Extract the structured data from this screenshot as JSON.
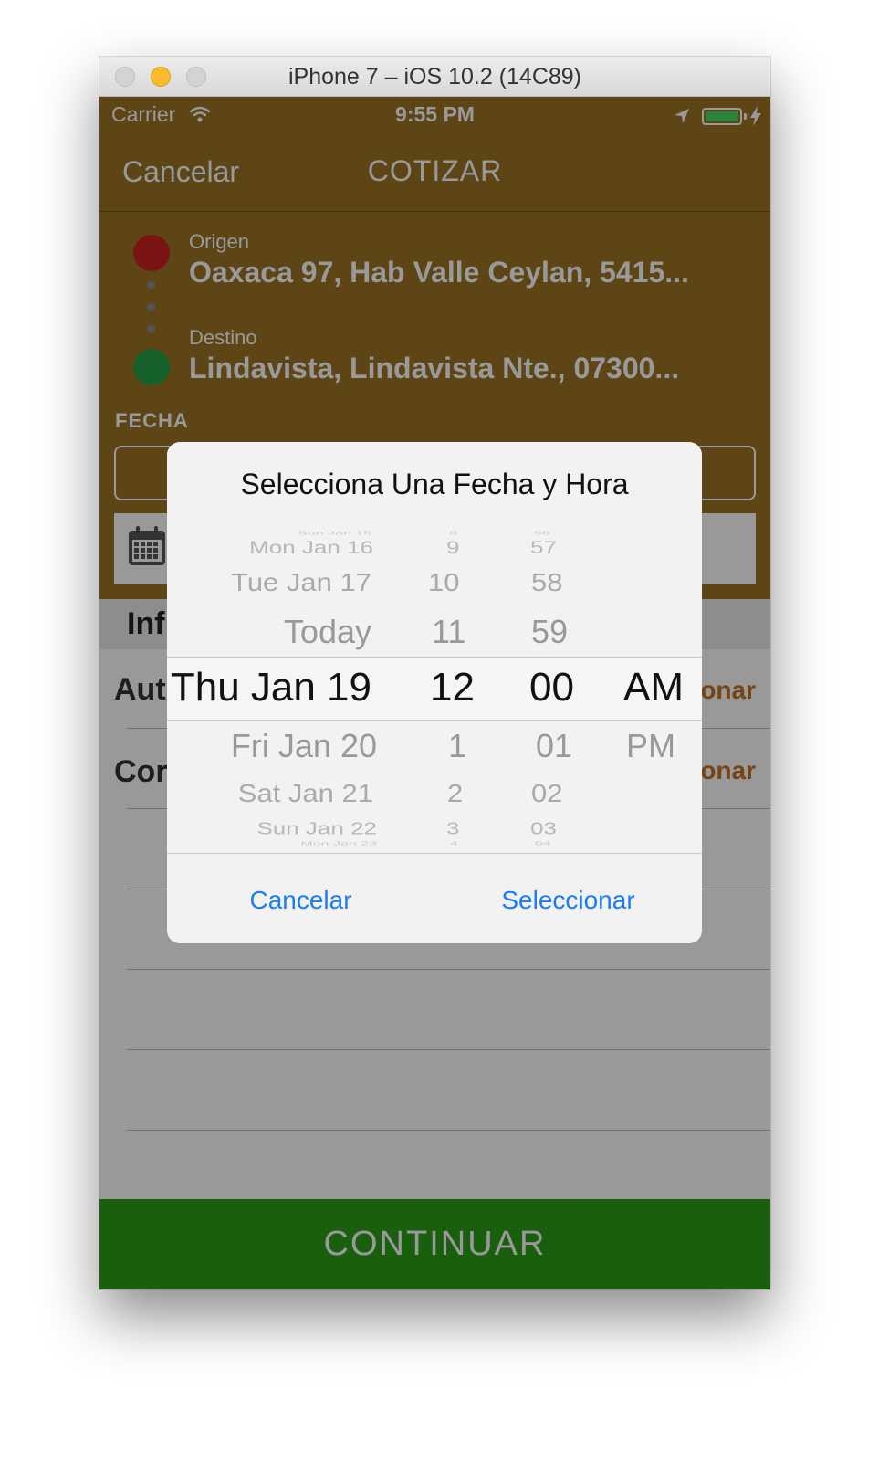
{
  "window": {
    "title": "iPhone 7 – iOS 10.2 (14C89)"
  },
  "status_bar": {
    "carrier": "Carrier",
    "time": "9:55 PM"
  },
  "nav": {
    "cancel": "Cancelar",
    "title": "COTIZAR"
  },
  "route": {
    "origin_label": "Origen",
    "origin_value": "Oaxaca 97, Hab Valle Ceylan, 5415...",
    "destination_label": "Destino",
    "destination_value": "Lindavista, Lindavista Nte., 07300..."
  },
  "fecha_label": "FECHA",
  "info": {
    "header": "Inf",
    "row1": "Aut",
    "row1_action": "onar",
    "row2": "Cor",
    "row2_action": "onar"
  },
  "continue_button": "CONTINUAR",
  "dialog": {
    "title": "Selecciona Una Fecha y Hora",
    "cancel": "Cancelar",
    "select": "Seleccionar",
    "picker": {
      "dates": [
        "Sun Jan 15",
        "Mon Jan 16",
        "Tue Jan 17",
        "Today",
        "Thu Jan 19",
        "Fri Jan 20",
        "Sat Jan 21",
        "Sun Jan 22",
        "Mon Jan 23"
      ],
      "hours": [
        "8",
        "9",
        "10",
        "11",
        "12",
        "1",
        "2",
        "3",
        "4"
      ],
      "minutes": [
        "56",
        "57",
        "58",
        "59",
        "00",
        "01",
        "02",
        "03",
        "04"
      ],
      "ampm": [
        "AM",
        "PM"
      ]
    }
  },
  "colors": {
    "header": "#9c7424",
    "continue": "#2a9e16",
    "link": "#1a7df5",
    "origin_dot": "#cc2020",
    "destination_dot": "#25a048"
  }
}
